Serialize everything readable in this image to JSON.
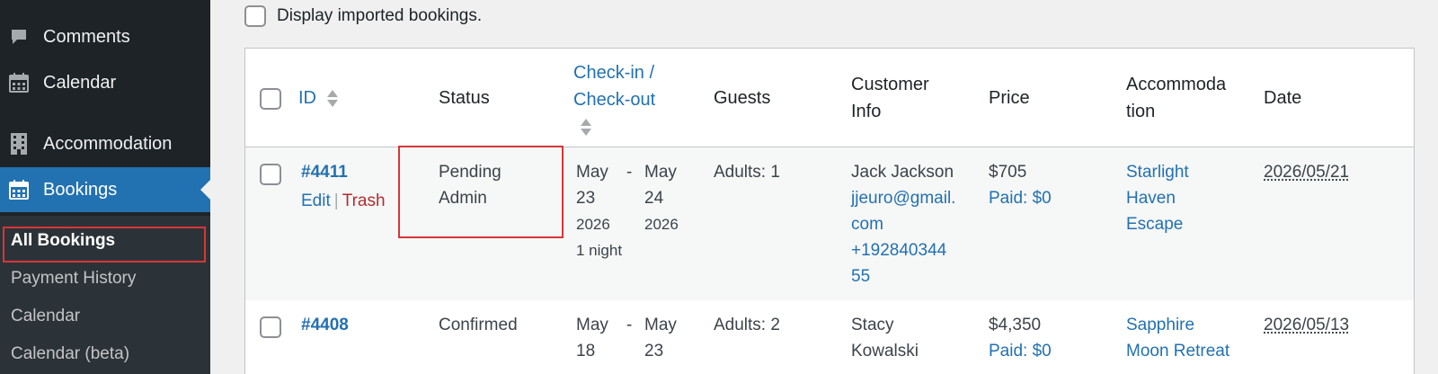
{
  "sidebar": {
    "items": [
      {
        "label": "Comments",
        "icon": "comment-bubble-icon"
      },
      {
        "label": "Calendar",
        "icon": "calendar-icon"
      },
      {
        "label": "Accommodation",
        "icon": "building-icon"
      },
      {
        "label": "Bookings",
        "icon": "calendar-icon"
      }
    ],
    "submenu": [
      "All Bookings",
      "Payment History",
      "Calendar",
      "Calendar (beta)"
    ]
  },
  "filter": {
    "import_label": "Display imported bookings."
  },
  "table": {
    "headers": {
      "id": "ID",
      "status": "Status",
      "checkin_line1": "Check-in /",
      "checkin_line2": "Check-out",
      "guests": "Guests",
      "customer_line1": "Customer",
      "customer_line2": "Info",
      "price": "Price",
      "accommodation_line1": "Accommoda",
      "accommodation_line2": "tion",
      "date": "Date"
    },
    "rows": [
      {
        "id": "#4411",
        "edit": "Edit",
        "sep": "|",
        "trash": "Trash",
        "status_line1": "Pending",
        "status_line2": "Admin",
        "checkin_month": "May",
        "checkin_day": "23",
        "checkin_year": "2026",
        "dash": "-",
        "checkout_month": "May",
        "checkout_day": "24",
        "checkout_year": "2026",
        "nights": "1 night",
        "guests": "Adults: 1",
        "customer_name": "Jack Jackson",
        "email_line1": "jjeuro@gmail.",
        "email_line2": "com",
        "phone_line1": "+192840344",
        "phone_line2": "55",
        "price": "$705",
        "paid": "Paid: $0",
        "accommodation_line1": "Starlight",
        "accommodation_line2": "Haven",
        "accommodation_line3": "Escape",
        "date": "2026/05/21"
      },
      {
        "id": "#4408",
        "status_line1": "Confirmed",
        "checkin_month": "May",
        "checkin_day": "18",
        "dash": "-",
        "checkout_month": "May",
        "checkout_day": "23",
        "guests": "Adults: 2",
        "customer_line1": "Stacy",
        "customer_line2": "Kowalski",
        "price": "$4,350",
        "paid": "Paid: $0",
        "accommodation_line1": "Sapphire",
        "accommodation_line2": "Moon Retreat",
        "date": "2026/05/13"
      }
    ]
  },
  "colors": {
    "accent": "#2271b1",
    "highlight": "#d63638",
    "sidebar": "#1d2327",
    "trash": "#b32d2e"
  }
}
